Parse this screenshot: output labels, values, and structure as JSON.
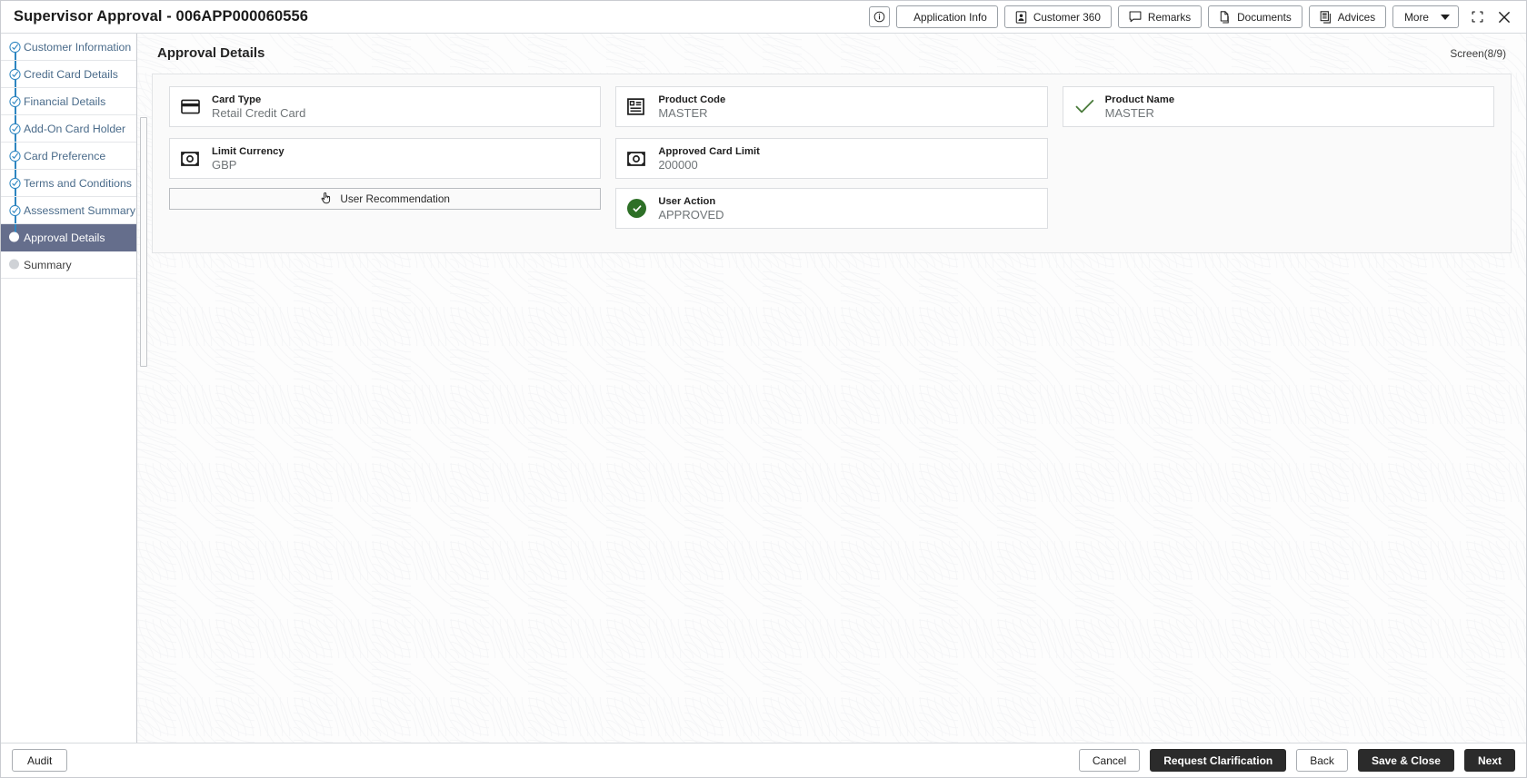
{
  "titlebar": {
    "title": "Supervisor Approval - 006APP000060556",
    "info_icon": "info-circle-icon",
    "buttons": [
      {
        "label": "Application Info",
        "icon": "application-info-icon"
      },
      {
        "label": "Customer 360",
        "icon": "customer-360-icon"
      },
      {
        "label": "Remarks",
        "icon": "remarks-icon"
      },
      {
        "label": "Documents",
        "icon": "documents-icon"
      },
      {
        "label": "Advices",
        "icon": "advices-icon"
      }
    ],
    "more_label": "More",
    "minimize_icon": "collapse-icon",
    "close_icon": "close-icon"
  },
  "sidebar": {
    "items": [
      {
        "label": "Customer Information",
        "state": "done"
      },
      {
        "label": "Credit Card Details",
        "state": "done"
      },
      {
        "label": "Financial Details",
        "state": "done"
      },
      {
        "label": "Add-On Card Holder",
        "state": "done"
      },
      {
        "label": "Card Preference",
        "state": "done"
      },
      {
        "label": "Terms and Conditions",
        "state": "done"
      },
      {
        "label": "Assessment Summary",
        "state": "done"
      },
      {
        "label": "Approval Details",
        "state": "active"
      },
      {
        "label": "Summary",
        "state": "pending"
      }
    ]
  },
  "main": {
    "page_title": "Approval Details",
    "screen_count": "Screen(8/9)",
    "fields": [
      {
        "label": "Card Type",
        "value": "Retail Credit Card",
        "icon": "credit-card-icon"
      },
      {
        "label": "Product Code",
        "value": "MASTER",
        "icon": "product-code-icon"
      },
      {
        "label": "Product Name",
        "value": "MASTER",
        "icon": "check-mark-icon"
      },
      {
        "label": "Limit Currency",
        "value": "GBP",
        "icon": "money-icon"
      },
      {
        "label": "Approved Card Limit",
        "value": "200000",
        "icon": "money-icon"
      }
    ],
    "recommendation_button": {
      "label": "User Recommendation",
      "icon": "hand-pointer-icon"
    },
    "user_action": {
      "label": "User Action",
      "value": "APPROVED",
      "icon": "green-check-circle-icon"
    }
  },
  "footer": {
    "audit_label": "Audit",
    "cancel_label": "Cancel",
    "request_clarification_label": "Request Clarification",
    "back_label": "Back",
    "save_close_label": "Save & Close",
    "next_label": "Next"
  },
  "colors": {
    "rail": "#2e86c1",
    "active_item": "#656e8c",
    "success_green": "#2e7027",
    "dark_button": "#2b2b2b"
  }
}
